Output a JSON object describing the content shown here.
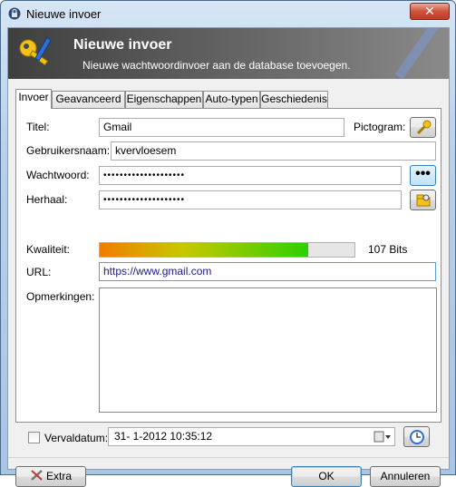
{
  "window": {
    "title": "Nieuwe invoer",
    "close_label": "✕"
  },
  "banner": {
    "title": "Nieuwe invoer",
    "subtitle": "Nieuwe wachtwoordinvoer aan de database toevoegen."
  },
  "tabs": [
    {
      "label": "Invoer",
      "active": true
    },
    {
      "label": "Geavanceerd",
      "active": false
    },
    {
      "label": "Eigenschappen",
      "active": false
    },
    {
      "label": "Auto-typen",
      "active": false
    },
    {
      "label": "Geschiedenis",
      "active": false
    }
  ],
  "form": {
    "title_label": "Titel:",
    "title_value": "Gmail",
    "icon_label": "Pictogram:",
    "username_label": "Gebruikersnaam:",
    "username_value": "kvervloesem",
    "password_label": "Wachtwoord:",
    "password_value": "••••••••••••••••••••",
    "repeat_label": "Herhaal:",
    "repeat_value": "••••••••••••••••••••",
    "quality_label": "Kwaliteit:",
    "quality_percent": 82,
    "quality_text": "107 Bits",
    "url_label": "URL:",
    "url_value": "https://www.gmail.com",
    "notes_label": "Opmerkingen:",
    "notes_value": "",
    "expiry_label": "Vervaldatum:",
    "expiry_checked": false,
    "expiry_value": "31-  1-2012 10:35:12"
  },
  "buttons": {
    "extra": "Extra",
    "ok": "OK",
    "cancel": "Annuleren"
  },
  "colors": {
    "banner": "#4a4a4a",
    "quality_start": "#f07d00",
    "quality_end": "#2ed000",
    "focus": "#569de5"
  }
}
